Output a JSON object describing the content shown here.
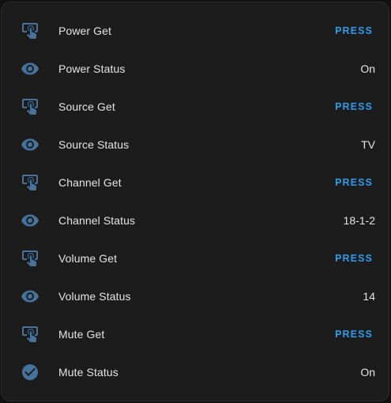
{
  "colors": {
    "card_background": "#1c1c1c",
    "icon": "#44739e",
    "press_text": "#2e9bea",
    "text": "#e3e3e3"
  },
  "rows": [
    {
      "label": "Power Get",
      "icon": "gesture-tap-button-icon",
      "action": "PRESS"
    },
    {
      "label": "Power Status",
      "icon": "eye-icon",
      "value": "On"
    },
    {
      "label": "Source Get",
      "icon": "gesture-tap-button-icon",
      "action": "PRESS"
    },
    {
      "label": "Source Status",
      "icon": "eye-icon",
      "value": "TV"
    },
    {
      "label": "Channel Get",
      "icon": "gesture-tap-button-icon",
      "action": "PRESS"
    },
    {
      "label": "Channel Status",
      "icon": "eye-icon",
      "value": "18-1-2"
    },
    {
      "label": "Volume Get",
      "icon": "gesture-tap-button-icon",
      "action": "PRESS"
    },
    {
      "label": "Volume Status",
      "icon": "eye-icon",
      "value": "14"
    },
    {
      "label": "Mute Get",
      "icon": "gesture-tap-button-icon",
      "action": "PRESS"
    },
    {
      "label": "Mute Status",
      "icon": "check-circle-icon",
      "value": "On"
    }
  ]
}
